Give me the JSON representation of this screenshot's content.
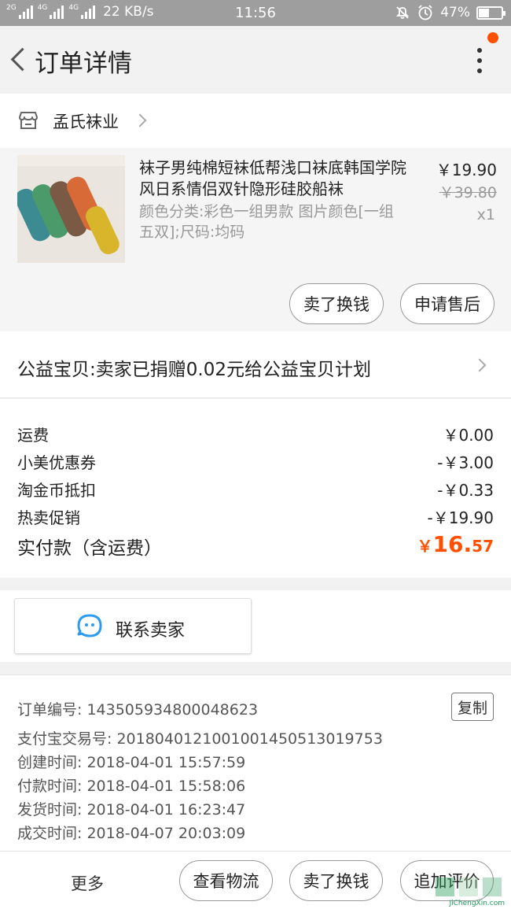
{
  "status_bar": {
    "network_1": "2G",
    "network_2": "4G",
    "network_3": "4G",
    "speed": "22 KB/s",
    "time": "11:56",
    "battery": "47%",
    "battery_level": 0.47
  },
  "header": {
    "title": "订单详情"
  },
  "shop": {
    "name": "孟氏袜业"
  },
  "item": {
    "title": "袜子男纯棉短袜低帮浅口袜底韩国学院风日系情侣双针隐形硅胶船袜",
    "sku": "颜色分类:彩色一组男款 图片颜色[一组五双];尺码:均码",
    "price": "￥19.90",
    "original_price": "￥39.80",
    "quantity": "x1",
    "buttons": {
      "sell": "卖了换钱",
      "after_sales": "申请售后"
    }
  },
  "charity": {
    "text": "公益宝贝:卖家已捐赠0.02元给公益宝贝计划"
  },
  "costs": {
    "rows": [
      {
        "label": "运费",
        "value": "￥0.00"
      },
      {
        "label": "小美优惠券",
        "value": "-￥3.00"
      },
      {
        "label": "淘金币抵扣",
        "value": "-￥0.33"
      },
      {
        "label": "热卖促销",
        "value": "-￥19.90"
      }
    ],
    "total_label": "实付款（含运费）",
    "total_currency": "￥",
    "total_integer": "16.",
    "total_decimal": "57"
  },
  "contact": {
    "label": "联系卖家"
  },
  "order_info": {
    "order_no": "订单编号: 143505934800048623",
    "alipay_no": "支付宝交易号: 2018040121001001450513019753",
    "created": "创建时间: 2018-04-01 15:57:59",
    "paid": "付款时间: 2018-04-01 15:58:06",
    "shipped": "发货时间: 2018-04-01 16:23:47",
    "completed": "成交时间: 2018-04-07 20:03:09",
    "copy_label": "复制"
  },
  "bottom_bar": {
    "more": "更多",
    "logistics": "查看物流",
    "sell": "卖了换钱",
    "review": "追加评价"
  },
  "watermark": "JiChengXin.com",
  "colors": {
    "accent": "#ff5000",
    "status_bar": "#9e9e9e",
    "watermark": "#1a9a5a"
  }
}
